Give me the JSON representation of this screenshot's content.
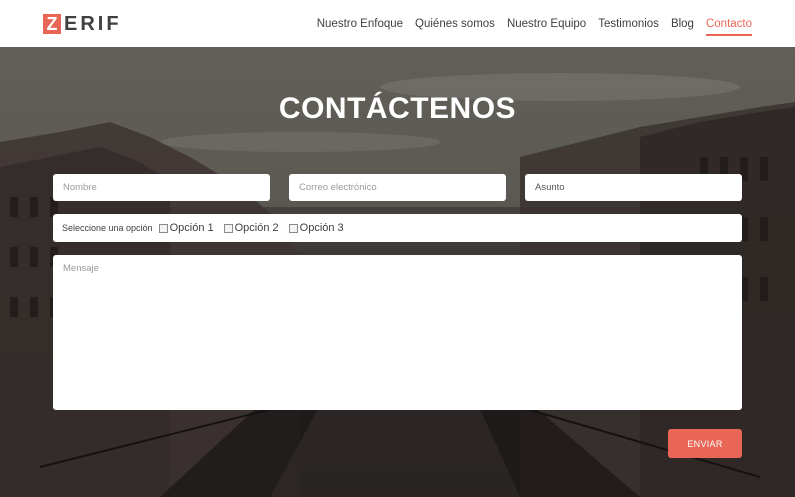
{
  "header": {
    "logo_initial": "Z",
    "logo_rest": "ERIF",
    "nav": [
      {
        "label": "Nuestro Enfoque"
      },
      {
        "label": "Quiénes somos"
      },
      {
        "label": "Nuestro Equipo"
      },
      {
        "label": "Testimonios"
      },
      {
        "label": "Blog"
      },
      {
        "label": "Contacto"
      }
    ],
    "active_nav": "Contacto"
  },
  "hero": {
    "title": "CONTÁCTENOS"
  },
  "form": {
    "name_placeholder": "Nombre",
    "email_placeholder": "Correo electrónico",
    "subject_value": "Asunto",
    "options_label": "Seleccione una opción",
    "options": [
      "Opción 1",
      "Opción 2",
      "Opción 3"
    ],
    "message_placeholder": "Mensaje",
    "submit_label": "ENVIAR"
  },
  "colors": {
    "accent": "#e96656",
    "text": "#404040",
    "white": "#ffffff"
  }
}
